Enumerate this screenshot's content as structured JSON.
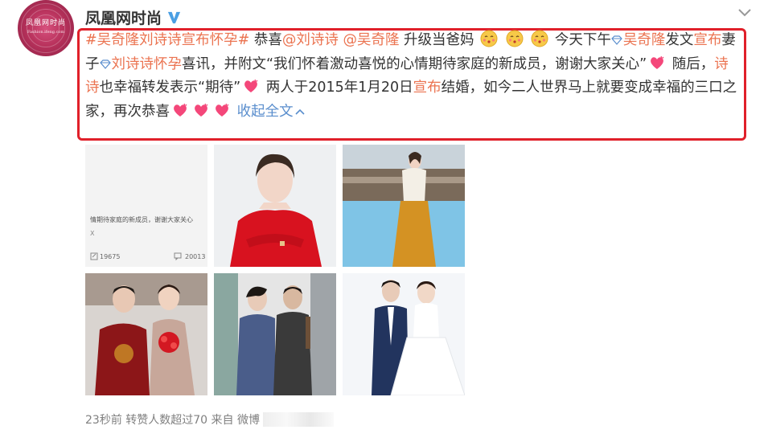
{
  "account": {
    "name": "凤凰网时尚",
    "avatar_text": "凤凰网时尚",
    "avatar_subtext": "Fashion.ifeng.com"
  },
  "post": {
    "hashtag": "#吴奇隆刘诗诗宣布怀孕#",
    "t_congrats": " 恭喜",
    "mention_1": "@刘诗诗",
    "mention_2": "@吴奇隆",
    "t_upgrade": " 升级当爸妈",
    "t_today": " 今天下午",
    "link_wu": "吴奇隆",
    "t_fa": "发文",
    "link_xuanbu": "宣布",
    "t_wife": "妻子",
    "link_topic": "刘诗诗怀孕",
    "t_news": "喜讯，并附文“我们怀着激动喜悦的心情期待家庭的新成员，谢谢大家关心”",
    "t_after": " 随后，",
    "link_shishi": "诗诗",
    "t_repost": "也幸福转发表示“期待”",
    "t_married1": " 两人于2015年1月20日",
    "link_xuanbu_2": "宣布",
    "t_married2": "结婚，如今二人世界马上就要变成幸福的三口之家，再次恭喜",
    "collapse": "收起全文"
  },
  "photos": [
    {
      "name": "screenshot",
      "caption": "情期待家庭的新成员，谢谢大家关心",
      "x_label": "X",
      "repost_count": "19675",
      "comment_count": "20013"
    },
    {
      "name": "red-jacket-woman"
    },
    {
      "name": "poolside-woman"
    },
    {
      "name": "wedding-traditional"
    },
    {
      "name": "couple-walking"
    },
    {
      "name": "wedding-western"
    }
  ],
  "footer": {
    "text": "23秒前 转赞人数超过70 来自 微博"
  },
  "colors": {
    "link": "#eb7350",
    "highlight_border": "#e0202a",
    "avatar": "#b8325c",
    "verified": "#4a9fe3"
  }
}
